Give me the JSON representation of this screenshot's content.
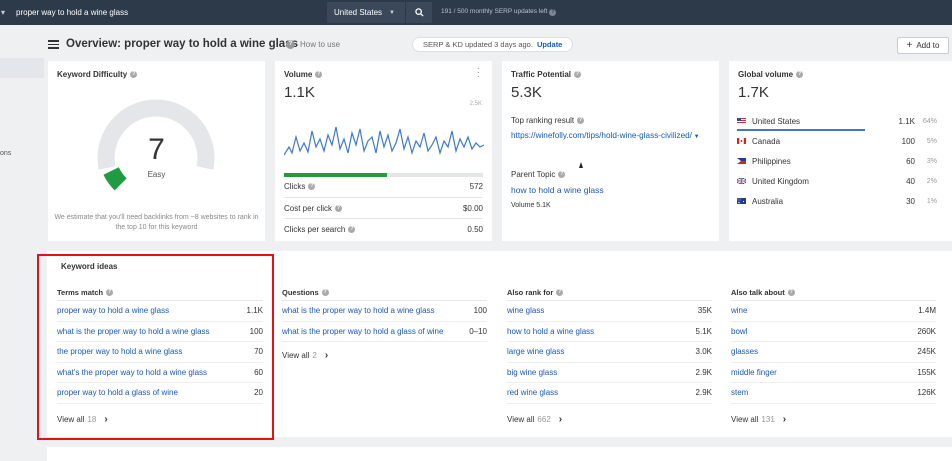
{
  "topbar": {
    "query": "proper way to hold a wine glass",
    "country": "United States",
    "serp_updates": "191 / 500 monthly SERP updates left"
  },
  "sidebar": {
    "partial_text": "ons"
  },
  "header": {
    "title": "Overview: proper way to hold a wine glass",
    "how_to_use": "How to use",
    "serp_status": "SERP & KD updated 3 days ago.",
    "update_label": "Update",
    "add_to_label": "Add to"
  },
  "keyword_difficulty": {
    "title": "Keyword Difficulty",
    "value": "7",
    "label": "Easy",
    "level": 0.07,
    "note": "We estimate that you'll need backlinks from ~8 websites to rank in the top 10 for this keyword"
  },
  "volume": {
    "title": "Volume",
    "value": "1.1K",
    "axis_max": "2.5K",
    "rows": [
      {
        "label": "Clicks",
        "value": "572"
      },
      {
        "label": "Cost per click",
        "value": "$0.00"
      },
      {
        "label": "Clicks per search",
        "value": "0.50"
      }
    ],
    "clicks_ratio": 0.52
  },
  "traffic_potential": {
    "title": "Traffic Potential",
    "value": "5.3K",
    "top_result_label": "Top ranking result",
    "top_result_url": "https://winefolly.com/tips/hold-wine-glass-civilized/",
    "parent_topic_label": "Parent Topic",
    "parent_topic": "how to hold a wine glass",
    "parent_volume": "Volume 5.1K"
  },
  "global_volume": {
    "title": "Global volume",
    "value": "1.7K",
    "countries": [
      {
        "name": "United States",
        "volume": "1.1K",
        "pct": "64%"
      },
      {
        "name": "Canada",
        "volume": "100",
        "pct": "5%"
      },
      {
        "name": "Philippines",
        "volume": "60",
        "pct": "3%"
      },
      {
        "name": "United Kingdom",
        "volume": "40",
        "pct": "2%"
      },
      {
        "name": "Australia",
        "volume": "30",
        "pct": "1%"
      }
    ]
  },
  "keyword_ideas": {
    "title": "Keyword ideas",
    "columns": [
      {
        "head": "Terms match",
        "rows": [
          {
            "kw": "proper way to hold a wine glass",
            "v": "1.1K"
          },
          {
            "kw": "what is the proper way to hold a wine glass",
            "v": "100"
          },
          {
            "kw": "the proper way to hold a wine glass",
            "v": "70"
          },
          {
            "kw": "what's the proper way to hold a wine glass",
            "v": "60"
          },
          {
            "kw": "proper way to hold a glass of wine",
            "v": "20"
          }
        ],
        "view_all": "View all",
        "count": "18"
      },
      {
        "head": "Questions",
        "rows": [
          {
            "kw": "what is the proper way to hold a wine glass",
            "v": "100"
          },
          {
            "kw": "what is the proper way to hold a glass of wine",
            "v": "0–10"
          }
        ],
        "view_all": "View all",
        "count": "2"
      },
      {
        "head": "Also rank for",
        "rows": [
          {
            "kw": "wine glass",
            "v": "35K"
          },
          {
            "kw": "how to hold a wine glass",
            "v": "5.1K"
          },
          {
            "kw": "large wine glass",
            "v": "3.0K"
          },
          {
            "kw": "big wine glass",
            "v": "2.9K"
          },
          {
            "kw": "red wine glass",
            "v": "2.9K"
          }
        ],
        "view_all": "View all",
        "count": "662"
      },
      {
        "head": "Also talk about",
        "rows": [
          {
            "kw": "wine",
            "v": "1.4M"
          },
          {
            "kw": "bowl",
            "v": "260K"
          },
          {
            "kw": "glasses",
            "v": "245K"
          },
          {
            "kw": "middle finger",
            "v": "155K"
          },
          {
            "kw": "stem",
            "v": "126K"
          }
        ],
        "view_all": "View all",
        "count": "131"
      }
    ]
  },
  "colors": {
    "accent": "#1a59b5",
    "kd_green": "#1e9b43",
    "highlight": "#e41313",
    "topbar": "#2d3a4a"
  }
}
